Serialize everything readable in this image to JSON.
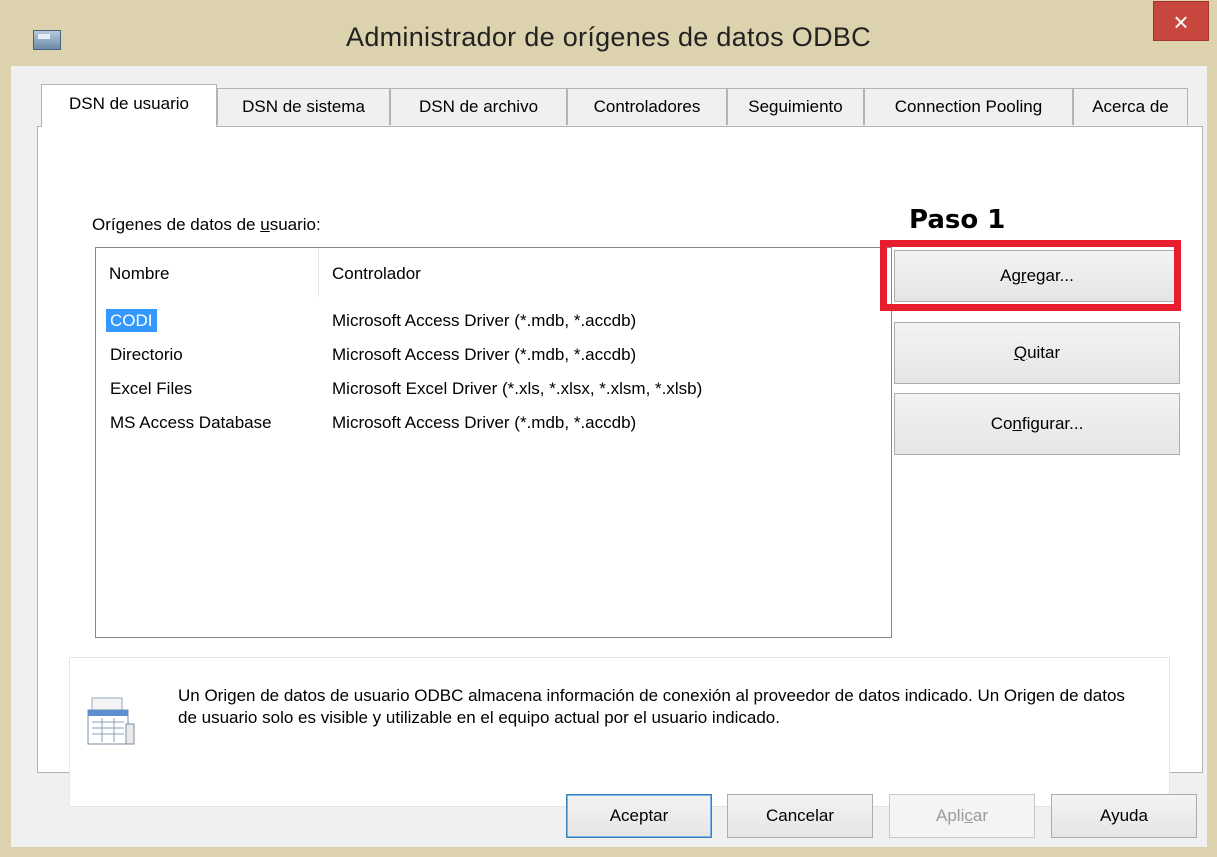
{
  "window": {
    "title": "Administrador de orígenes de datos ODBC",
    "close": "×"
  },
  "tabs": [
    {
      "label": "DSN de usuario",
      "active": true
    },
    {
      "label": "DSN de sistema"
    },
    {
      "label": "DSN de archivo"
    },
    {
      "label": "Controladores"
    },
    {
      "label": "Seguimiento"
    },
    {
      "label": "Connection Pooling"
    },
    {
      "label": "Acerca de"
    }
  ],
  "panel": {
    "group_label_pre": "Orígenes de datos de ",
    "group_label_u": "u",
    "group_label_post": "suario:",
    "annotation": "Paso 1",
    "columns": [
      "Nombre",
      "Controlador"
    ],
    "rows": [
      {
        "name": "CODI",
        "driver": "Microsoft Access Driver (*.mdb, *.accdb)",
        "selected": true
      },
      {
        "name": "Directorio",
        "driver": "Microsoft Access Driver (*.mdb, *.accdb)"
      },
      {
        "name": "Excel Files",
        "driver": "Microsoft Excel Driver (*.xls, *.xlsx, *.xlsm, *.xlsb)"
      },
      {
        "name": "MS Access Database",
        "driver": "Microsoft Access Driver (*.mdb, *.accdb)"
      }
    ],
    "buttons": {
      "add_pre": "Ag",
      "add_u": "r",
      "add_post": "egar...",
      "remove_u": "Q",
      "remove_post": "uitar",
      "configure_pre": "Co",
      "configure_u": "n",
      "configure_post": "figurar..."
    },
    "info_text": "Un Origen de datos de usuario ODBC almacena información de conexión al proveedor de datos indicado. Un Origen de datos de usuario solo es visible y utilizable en el equipo actual por el usuario indicado."
  },
  "footer": {
    "ok": "Aceptar",
    "cancel": "Cancelar",
    "apply_pre": "Apli",
    "apply_u": "c",
    "apply_post": "ar",
    "help": "Ayuda"
  },
  "colors": {
    "titlebar": "#dcd2ae",
    "close": "#c7463d",
    "highlight": "#e61e2d",
    "selection": "#3399ff"
  }
}
